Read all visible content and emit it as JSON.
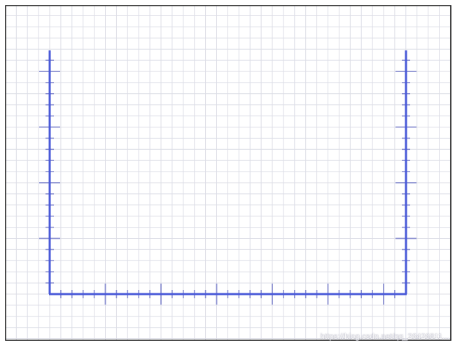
{
  "colors": {
    "background": "#ffffff",
    "border": "#111111",
    "grid": "#dcdde6",
    "axis": "#4a5ad8",
    "tick": "#8a8fd0"
  },
  "diagram": {
    "kind": "u-shaped-ruler-on-graph-paper",
    "tick_spacing_units": 1,
    "major_tick_every": 5
  },
  "watermark": {
    "text": "https://blog.csdn.net/qq_26426811..."
  }
}
